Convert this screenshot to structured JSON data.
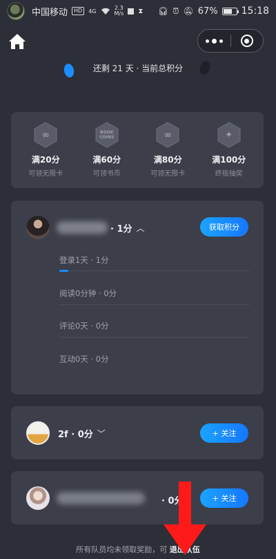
{
  "status_bar": {
    "carrier": "中国移动",
    "hd": "HD",
    "net_type": "4G",
    "net_speed": "2.3",
    "net_speed_unit": "M/s",
    "battery": "67%",
    "battery_level": 0.67,
    "time": "15:18"
  },
  "header": {
    "days_text": "还剩 21 天 · 当前总积分"
  },
  "rewards": [
    {
      "title": "满20分",
      "subtitle": "可领无限卡",
      "icon": "infinity-icon"
    },
    {
      "title": "满60分",
      "subtitle": "可领书币",
      "icon": "book-coins-icon",
      "icon_text": "BOOK COINS"
    },
    {
      "title": "满80分",
      "subtitle": "可领无限卡",
      "icon": "infinity-icon"
    },
    {
      "title": "满100分",
      "subtitle": "终极抽奖",
      "icon": "lottery-icon"
    }
  ],
  "team": {
    "member1": {
      "score": "· 1分",
      "chevron": "^",
      "button": "获取积分"
    },
    "tasks": [
      {
        "label": "登录1天 · 1分",
        "progress": 1
      },
      {
        "label": "阅读0分钟 · 0分",
        "progress": 0
      },
      {
        "label": "评论0天 · 0分",
        "progress": 0
      },
      {
        "label": "互动0天 · 0分",
        "progress": 0
      }
    ],
    "member2": {
      "name": "2f · 0分",
      "chevron": "⌄",
      "button": "+ 关注"
    },
    "member3": {
      "score": "· 0分",
      "button": "+ 关注"
    }
  },
  "footer": {
    "text": "所有队员均未领取奖励，可 ",
    "link": "退出队伍"
  },
  "colors": {
    "background": "#2c2e38",
    "card": "#3c3e49",
    "accent": "#1c8cff",
    "arrow": "#ff1a1a"
  }
}
